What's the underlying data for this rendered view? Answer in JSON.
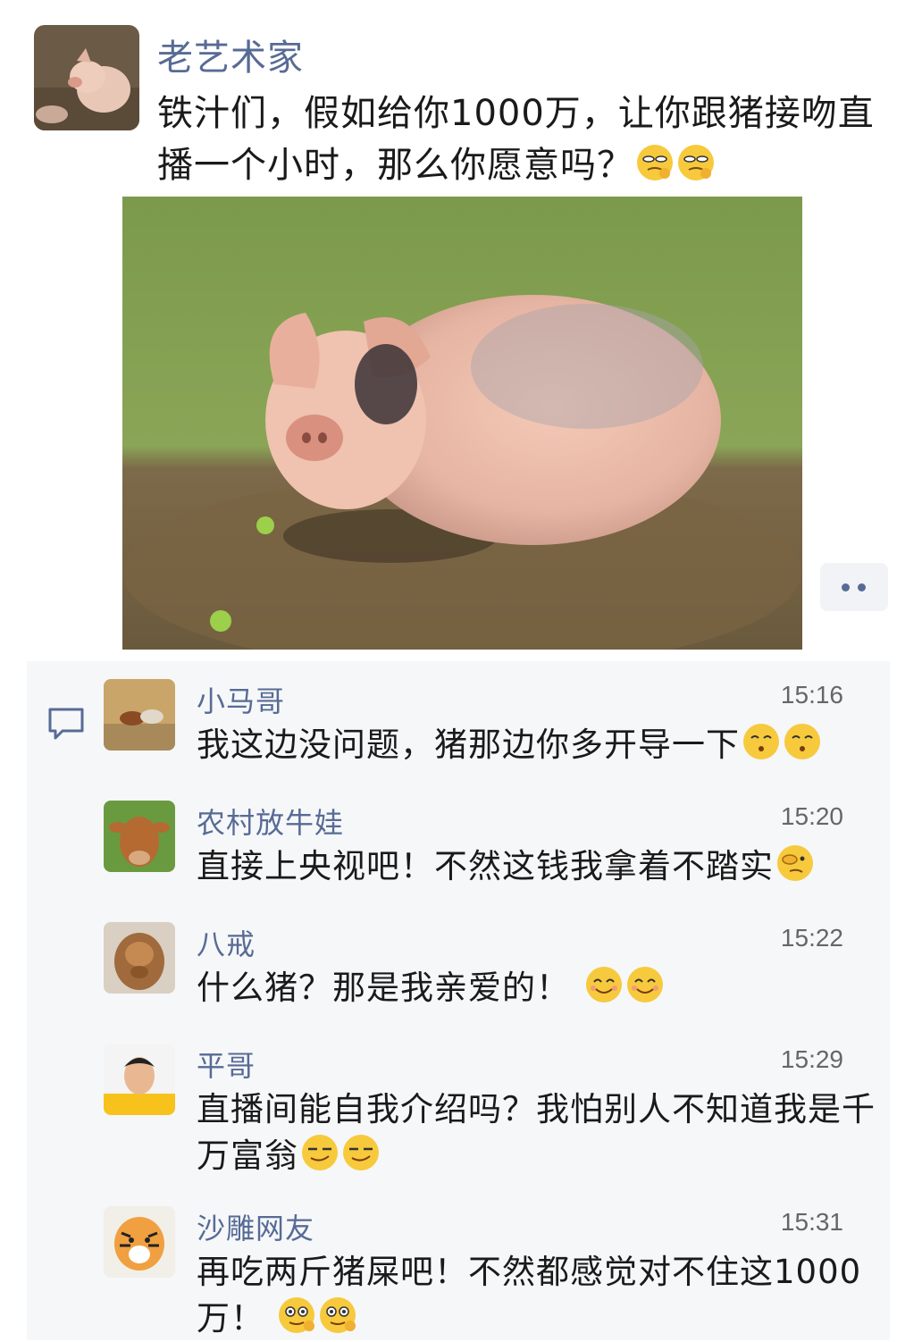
{
  "post": {
    "author": "老艺术家",
    "text": "铁汁们，假如给你1000万，让你跟猪接吻直播一个小时，那么你愿意吗？",
    "emojis": [
      "smirk-emoji",
      "smirk-emoji"
    ],
    "image": "pig-lying-in-field-photo"
  },
  "comments": [
    {
      "name": "小马哥",
      "time": "15:16",
      "text": "我这边没问题，猪那边你多开导一下",
      "emojis": [
        "kiss-emoji",
        "kiss-emoji"
      ],
      "avatar": "horses-avatar"
    },
    {
      "name": "农村放牛娃",
      "time": "15:20",
      "text": "直接上央视吧！不然这钱我拿着不踏实",
      "emojis": [
        "facepalm-emoji"
      ],
      "avatar": "cow-avatar"
    },
    {
      "name": "八戒",
      "time": "15:22",
      "text": "什么猪？那是我亲爱的！",
      "emojis": [
        "smile-emoji",
        "smile-emoji"
      ],
      "avatar": "statue-avatar"
    },
    {
      "name": "平哥",
      "time": "15:29",
      "text": "直播间能自我介绍吗？我怕别人不知道我是千万富翁",
      "emojis": [
        "smug-emoji",
        "smug-emoji"
      ],
      "avatar": "man-avatar"
    },
    {
      "name": "沙雕网友",
      "time": "15:31",
      "text": "再吃两斤猪屎吧！不然都感觉对不住这1000万！",
      "emojis": [
        "ok-emoji",
        "ok-emoji"
      ],
      "avatar": "tiger-avatar"
    }
  ],
  "colors": {
    "name": "#576b95",
    "text": "#1a1a1a",
    "panel": "#f6f7f9"
  }
}
